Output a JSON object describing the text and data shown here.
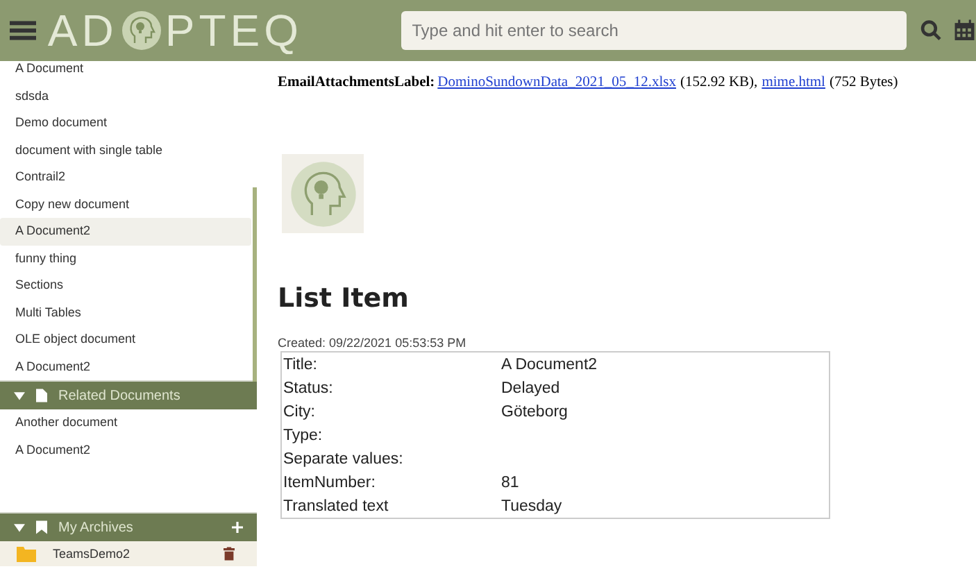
{
  "header": {
    "logo_left": "AD",
    "logo_right": "PTEQ",
    "search": {
      "placeholder": "Type and hit enter to search"
    }
  },
  "sidebar": {
    "documents": [
      {
        "label": "A Document",
        "selected": false
      },
      {
        "label": "sdsda",
        "selected": false
      },
      {
        "label": "Demo document",
        "selected": false
      },
      {
        "label": "document with single table",
        "selected": false
      },
      {
        "label": "Contrail2",
        "selected": false
      },
      {
        "label": "Copy new document",
        "selected": false
      },
      {
        "label": "A Document2",
        "selected": true
      },
      {
        "label": "funny thing",
        "selected": false
      },
      {
        "label": "Sections",
        "selected": false
      },
      {
        "label": "Multi Tables",
        "selected": false
      },
      {
        "label": "OLE object document",
        "selected": false
      },
      {
        "label": "A Document2",
        "selected": false
      }
    ],
    "related": {
      "title": "Related Documents",
      "expanded": true,
      "items": [
        "Another document",
        "A Document2"
      ]
    },
    "archives": {
      "title": "My Archives",
      "expanded": true,
      "items": [
        "TeamsDemo2"
      ]
    }
  },
  "content": {
    "attachments": {
      "label": "EmailAttachmentsLabel:",
      "files": [
        {
          "name": "DominoSundownData_2021_05_12.xlsx",
          "size": "(152.92 KB),"
        },
        {
          "name": "mime.html",
          "size": "(752 Bytes)"
        }
      ]
    },
    "heading": "List Item",
    "created": "Created: 09/22/2021 05:53:53 PM",
    "fields": [
      {
        "label": "Title:",
        "value": "A Document2"
      },
      {
        "label": "Status:",
        "value": "Delayed"
      },
      {
        "label": "City:",
        "value": "Göteborg"
      },
      {
        "label": "Type:"
      },
      {
        "label": "Separate values:"
      },
      {
        "label": "ItemNumber:",
        "value": "81"
      },
      {
        "label": "Translated text",
        "value": "Tuesday"
      }
    ]
  }
}
